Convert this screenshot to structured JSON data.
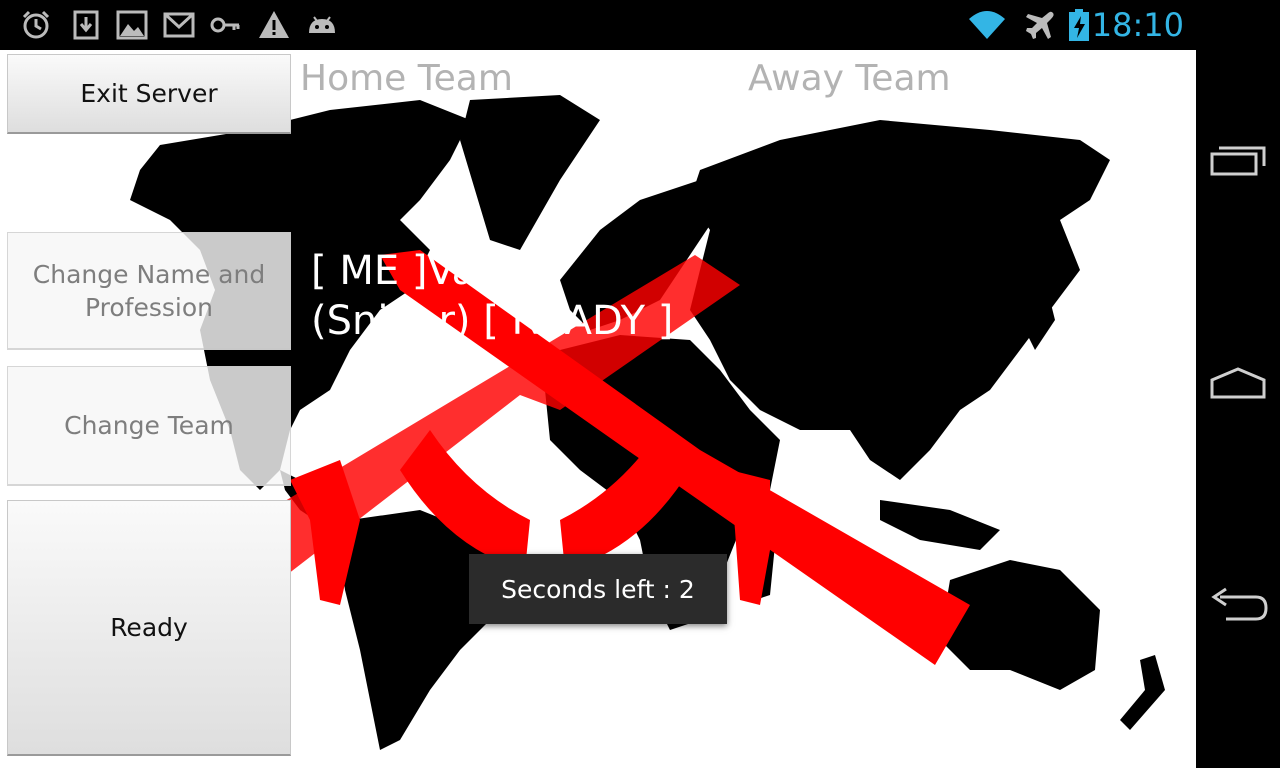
{
  "status_bar": {
    "left_icons": [
      "alarm-clock-icon",
      "download-icon",
      "image-icon",
      "gmail-icon",
      "key-icon",
      "warning-icon",
      "android-debug-icon"
    ],
    "right_icons": [
      "wifi-icon",
      "airplane-mode-icon",
      "battery-charging-icon"
    ],
    "time": "18:10",
    "accent_color": "#33b5e5"
  },
  "sidebar": {
    "exit_server_label": "Exit Server",
    "change_name_label": "Change Name and Profession",
    "change_team_label": "Change Team",
    "ready_label": "Ready"
  },
  "teams": {
    "home_label": "Home Team",
    "away_label": "Away Team"
  },
  "player": {
    "line1": "[ ME ]Vadim",
    "line2": "(Sniper) [ READY ]"
  },
  "toast": {
    "text": "Seconds left : 2"
  },
  "nav_bar": {
    "buttons": [
      "recent-apps-icon",
      "home-icon",
      "back-icon"
    ]
  },
  "colors": {
    "logo_red": "#ff0000",
    "map_black": "#000000"
  }
}
